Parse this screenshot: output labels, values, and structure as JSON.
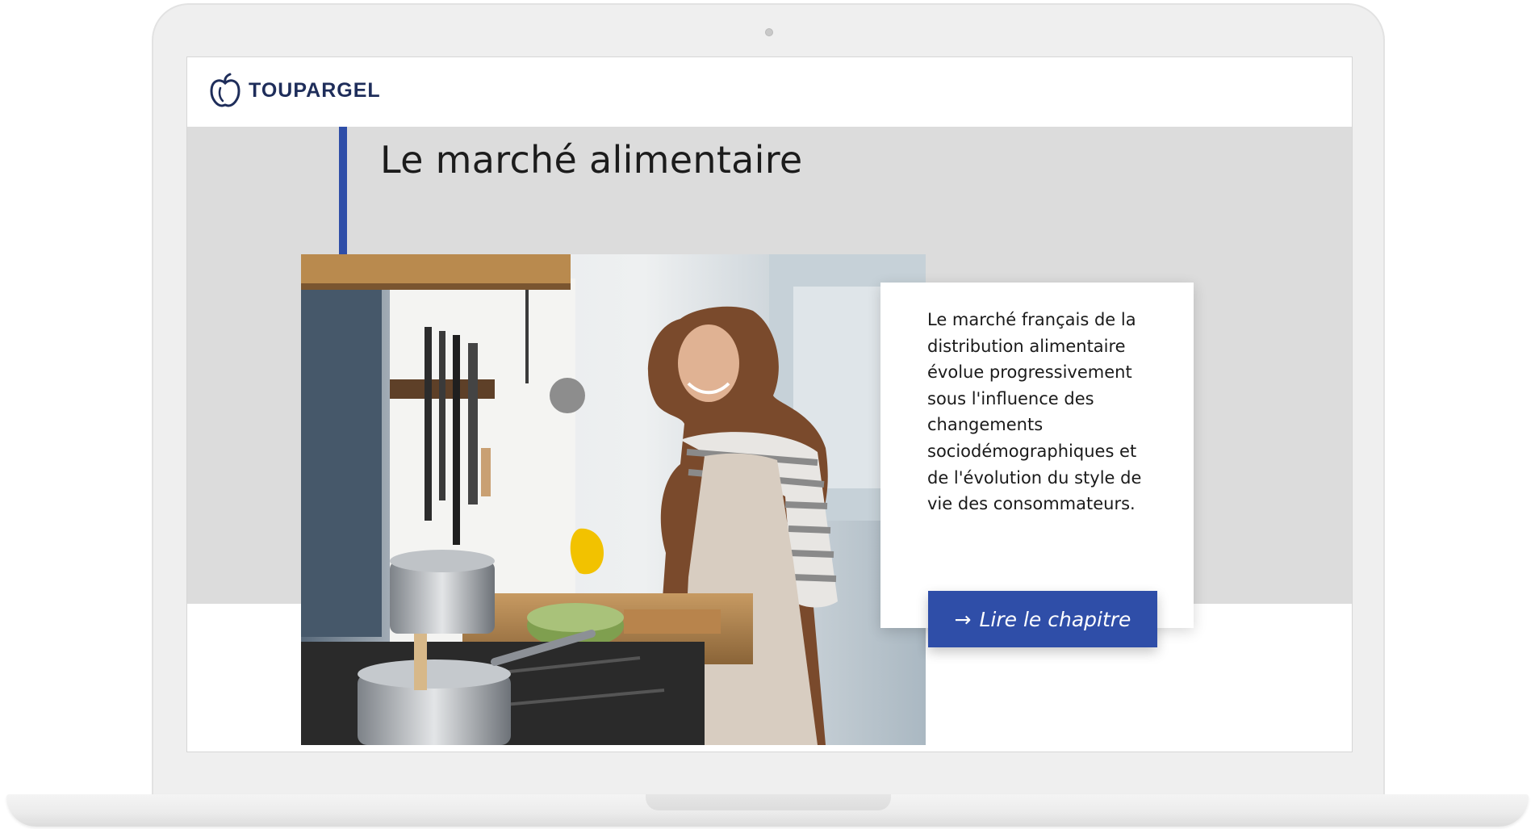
{
  "header": {
    "brand": "TOUPARGEL",
    "logo_icon": "apple-logo-icon"
  },
  "hero": {
    "title": "Le marché alimentaire",
    "image_alt": "Femme souriante cuisinant des légumes dans une cuisine"
  },
  "card": {
    "text": "Le marché français de la distribution alimentaire évolue progressivement sous l'influence des changements sociodémographiques et de l'évolution du style de vie des consommateurs.",
    "cta_arrow": "→",
    "cta_label": "Lire le chapitre"
  },
  "colors": {
    "accent": "#2f4ea8",
    "brand_text": "#1e2d5a",
    "band": "#dcdcdc"
  }
}
